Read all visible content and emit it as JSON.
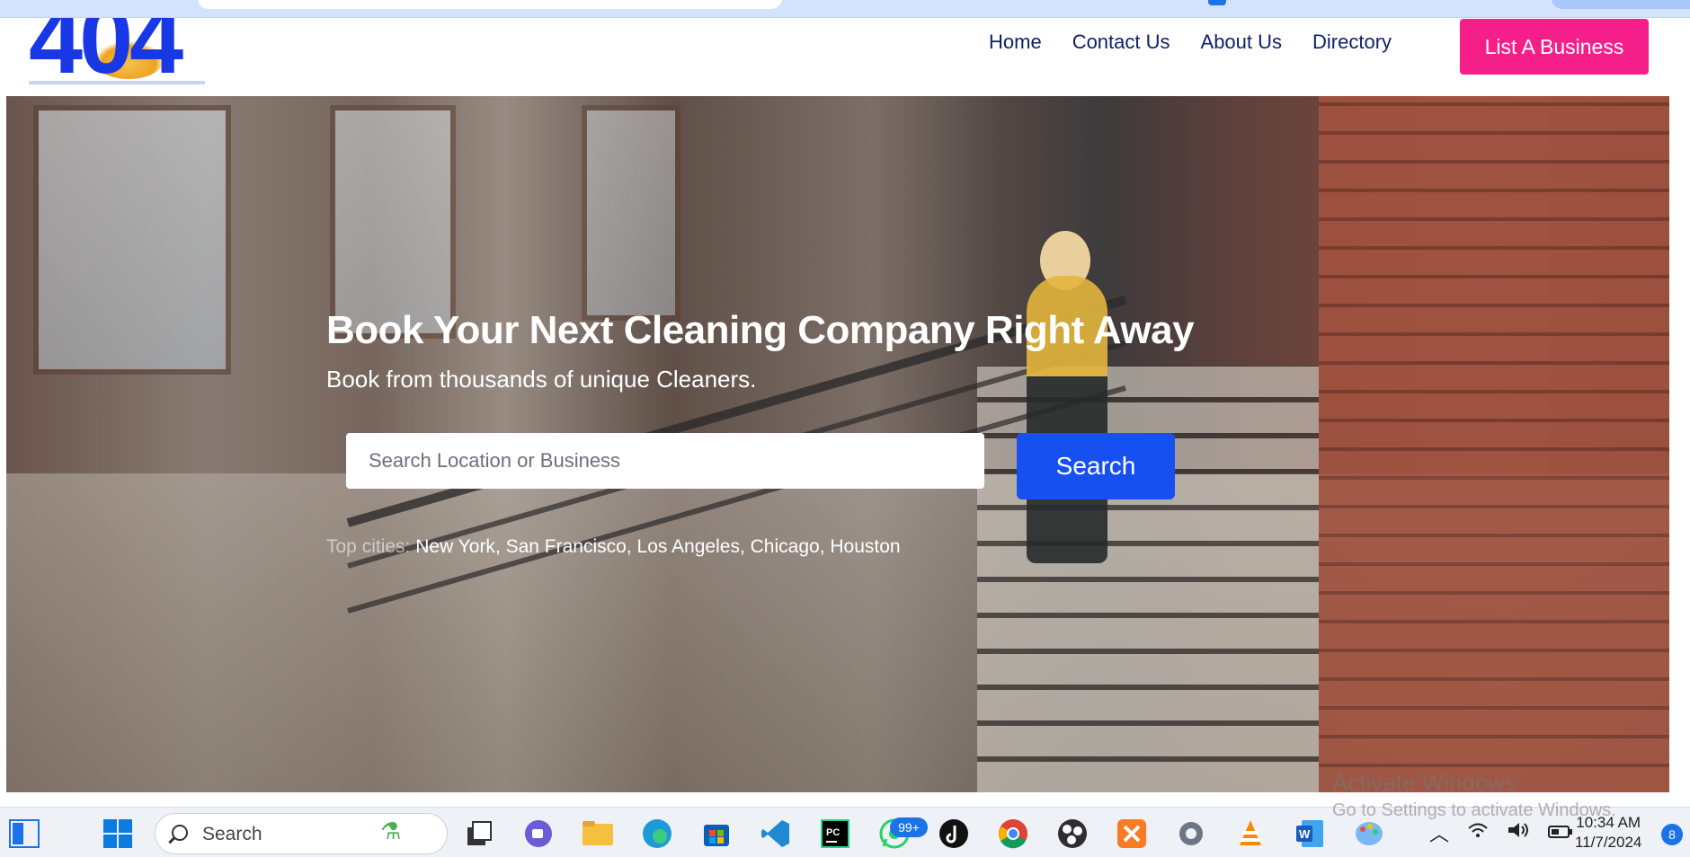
{
  "site": {
    "logo_text": "404",
    "nav": [
      "Home",
      "Contact Us",
      "About Us",
      "Directory"
    ],
    "cta_label": "List A Business"
  },
  "hero": {
    "title": "Book Your Next Cleaning Company Right Away",
    "subtitle": "Book from thousands of unique Cleaners.",
    "search_placeholder": "Search Location or Business",
    "search_button": "Search",
    "top_cities_label": "Top cities:",
    "cities": [
      "New York",
      "San Francisco",
      "Los Angeles",
      "Chicago",
      "Houston"
    ]
  },
  "watermark": {
    "line1": "Activate Windows",
    "line2": "Go to Settings to activate Windows."
  },
  "taskbar": {
    "search_label": "Search",
    "whatsapp_badge": "99+",
    "time": "10:34 AM",
    "date": "11/7/2024",
    "notification_count": "8",
    "apps": [
      "widgets-icon",
      "start-icon",
      "task-view-icon",
      "teams-icon",
      "file-explorer-icon",
      "edge-icon",
      "store-icon",
      "vscode-icon",
      "pycharm-icon",
      "whatsapp-icon",
      "tiktok-icon",
      "chrome-icon",
      "obs-icon",
      "xampp-icon",
      "settings-icon",
      "vlc-icon",
      "word-icon",
      "paint-icon"
    ]
  },
  "colors": {
    "brand_blue": "#1838e6",
    "cta_pink": "#f51f8a",
    "search_blue": "#1750f0",
    "nav_text": "#0c1f6b"
  }
}
